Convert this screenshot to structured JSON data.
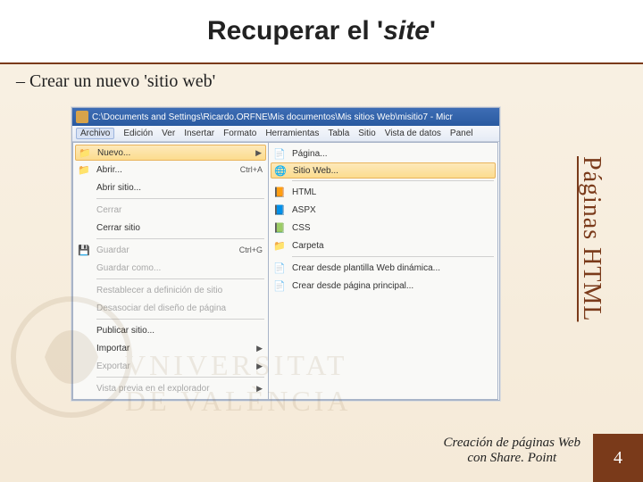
{
  "title": {
    "pre": "Recuperar el '",
    "ital": "site",
    "post": "'"
  },
  "bullet": "–  Crear un nuevo 'sitio web'",
  "side_label": "Páginas HTML",
  "footer": {
    "line1": "Creación de páginas Web",
    "line2": "con Share. Point"
  },
  "page_number": "4",
  "ss": {
    "window_title": "C:\\Documents and Settings\\Ricardo.ORFNE\\Mis documentos\\Mis sitios Web\\misitio7 - Micr",
    "menus": [
      "Archivo",
      "Edición",
      "Ver",
      "Insertar",
      "Formato",
      "Herramientas",
      "Tabla",
      "Sitio",
      "Vista de datos",
      "Panel"
    ],
    "dropdown": [
      {
        "type": "item",
        "icon": "folder",
        "label": "Nuevo...",
        "shortcut": "",
        "arrow": true,
        "highlight": true
      },
      {
        "type": "item",
        "icon": "folder",
        "label": "Abrir...",
        "shortcut": "Ctrl+A"
      },
      {
        "type": "item",
        "icon": "",
        "label": "Abrir sitio..."
      },
      {
        "type": "sep"
      },
      {
        "type": "item",
        "icon": "",
        "label": "Cerrar",
        "disabled": true
      },
      {
        "type": "item",
        "icon": "",
        "label": "Cerrar sitio"
      },
      {
        "type": "sep"
      },
      {
        "type": "item",
        "icon": "save",
        "label": "Guardar",
        "shortcut": "Ctrl+G",
        "disabled": true
      },
      {
        "type": "item",
        "icon": "",
        "label": "Guardar como...",
        "disabled": true
      },
      {
        "type": "sep"
      },
      {
        "type": "item",
        "icon": "",
        "label": "Restablecer a definición de sitio",
        "disabled": true
      },
      {
        "type": "item",
        "icon": "",
        "label": "Desasociar del diseño de página",
        "disabled": true
      },
      {
        "type": "sep"
      },
      {
        "type": "item",
        "icon": "",
        "label": "Publicar sitio..."
      },
      {
        "type": "item",
        "icon": "",
        "label": "Importar",
        "arrow": true
      },
      {
        "type": "item",
        "icon": "",
        "label": "Exportar",
        "arrow": true,
        "disabled": true
      },
      {
        "type": "sep"
      },
      {
        "type": "item",
        "icon": "",
        "label": "Vista previa en el explorador",
        "arrow": true,
        "disabled": true
      }
    ],
    "submenu": [
      {
        "type": "item",
        "icon": "page",
        "label": "Página..."
      },
      {
        "type": "item",
        "icon": "globe",
        "label": "Sitio Web...",
        "highlight": true
      },
      {
        "type": "sep"
      },
      {
        "type": "item",
        "icon": "html",
        "label": "HTML"
      },
      {
        "type": "item",
        "icon": "aspx",
        "label": "ASPX"
      },
      {
        "type": "item",
        "icon": "css",
        "label": "CSS"
      },
      {
        "type": "item",
        "icon": "folder",
        "label": "Carpeta"
      },
      {
        "type": "sep"
      },
      {
        "type": "item",
        "icon": "page",
        "label": "Crear desde plantilla Web dinámica..."
      },
      {
        "type": "item",
        "icon": "page",
        "label": "Crear desde página principal..."
      }
    ]
  }
}
